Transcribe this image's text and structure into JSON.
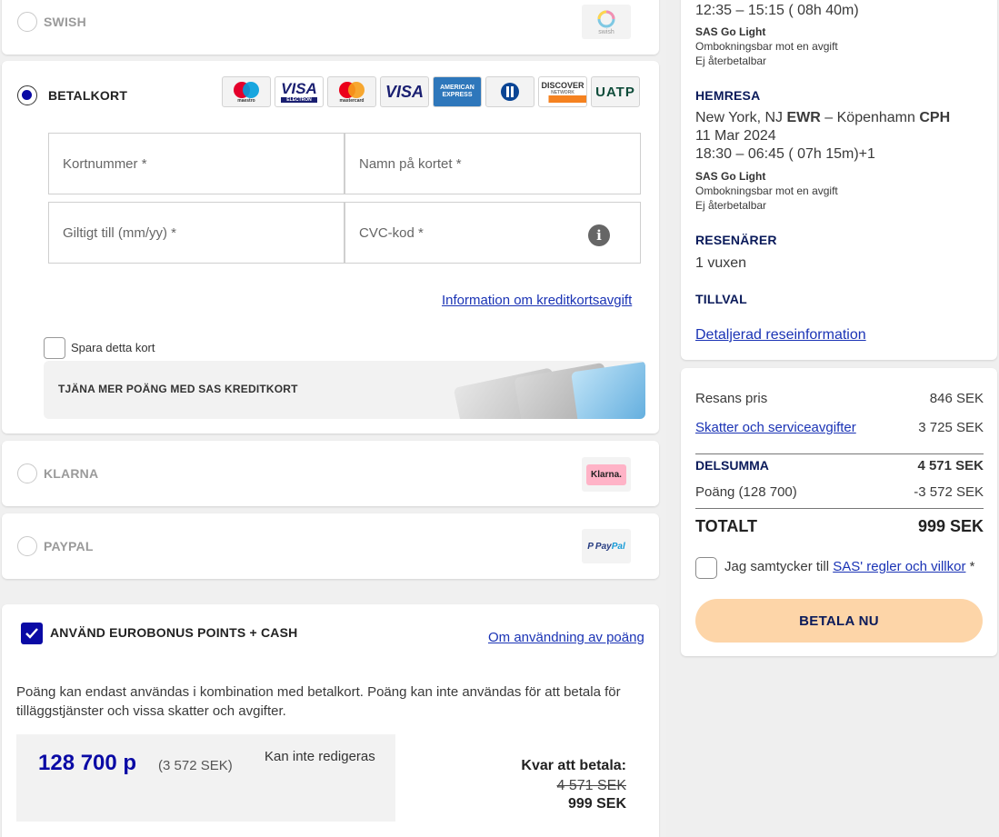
{
  "payment": {
    "swish": {
      "label": "SWISH",
      "logo_text": "swish"
    },
    "betalkort": {
      "label": "BETALKORT",
      "card_logos": [
        {
          "name": "maestro-logo",
          "text": "maestro"
        },
        {
          "name": "visa-electron-logo",
          "text": "VISA",
          "sub": "ELECTRON"
        },
        {
          "name": "mastercard-logo",
          "text": "mastercard"
        },
        {
          "name": "visa-logo",
          "text": "VISA"
        },
        {
          "name": "american-express-logo",
          "text": "AMERICAN EXPRESS"
        },
        {
          "name": "diners-club-logo",
          "text": ""
        },
        {
          "name": "discover-logo",
          "text": "DISCOVER",
          "sub": "NETWORK"
        },
        {
          "name": "uatp-logo",
          "text": "UATP"
        }
      ],
      "card_number_placeholder": "Kortnummer *",
      "card_name_placeholder": "Namn på kortet *",
      "expiry_placeholder": "Giltigt till (mm/yy) *",
      "cvc_placeholder": "CVC-kod *",
      "fee_info_link": "Information om kreditkortsavgift",
      "save_card_label": "Spara detta kort",
      "promo_text": "TJÄNA MER POÄNG MED SAS KREDITKORT"
    },
    "klarna": {
      "label": "KLARNA",
      "logo_text": "Klarna."
    },
    "paypal": {
      "label": "PAYPAL",
      "logo_text_1": "Pay",
      "logo_text_2": "Pal"
    }
  },
  "eurobonus": {
    "checkbox_label": "ANVÄND EUROBONUS POINTS + CASH",
    "info_link": "Om användning av poäng",
    "description": "Poäng kan endast användas i kombination med betalkort. Poäng kan inte användas för att betala för tilläggstjänster och vissa skatter och avgifter.",
    "points_value": "128 700 p",
    "points_sek": "(3 572 SEK)",
    "not_editable": "Kan inte redigeras",
    "remaining_label": "Kvar att betala:",
    "old_amount": "4 571 SEK",
    "new_amount": "999 SEK"
  },
  "summary": {
    "outbound_time": "12:35 – 15:15 ( 08h 40m)",
    "outbound_fare": "SAS Go Light",
    "outbound_rebook": "Ombokningsbar mot en avgift",
    "outbound_refund": "Ej återbetalbar",
    "return_heading": "HEMRESA",
    "return_route_from": "New York, NJ",
    "return_from_code": "EWR",
    "return_route_sep": " – Köpenhamn",
    "return_to_code": "CPH",
    "return_date": "11 Mar 2024",
    "return_time": "18:30 – 06:45 ( 07h 15m)+1",
    "return_fare": "SAS Go Light",
    "return_rebook": "Ombokningsbar mot en avgift",
    "return_refund": "Ej återbetalbar",
    "travelers_heading": "RESENÄRER",
    "travelers": "1 vuxen",
    "extras_heading": "TILLVAL",
    "details_link": "Detaljerad reseinformation"
  },
  "price": {
    "fare_label": "Resans pris",
    "fare_value": "846 SEK",
    "taxes_label": "Skatter och serviceavgifter",
    "taxes_value": "3 725 SEK",
    "subtotal_label": "DELSUMMA",
    "subtotal_value": "4 571 SEK",
    "points_label": "Poäng (128 700)",
    "points_value": "-3 572 SEK",
    "total_label": "TOTALT",
    "total_value": "999 SEK",
    "consent_prefix": "Jag samtycker till ",
    "consent_link": "SAS' regler och villkor",
    "consent_suffix": " *",
    "pay_button": "BETALA NU"
  },
  "colors": {
    "accent_blue": "#0a0aa5",
    "link_blue": "#1a33b5",
    "pay_button_bg": "#fdd5a8",
    "heading_navy": "#0a1a5a"
  }
}
